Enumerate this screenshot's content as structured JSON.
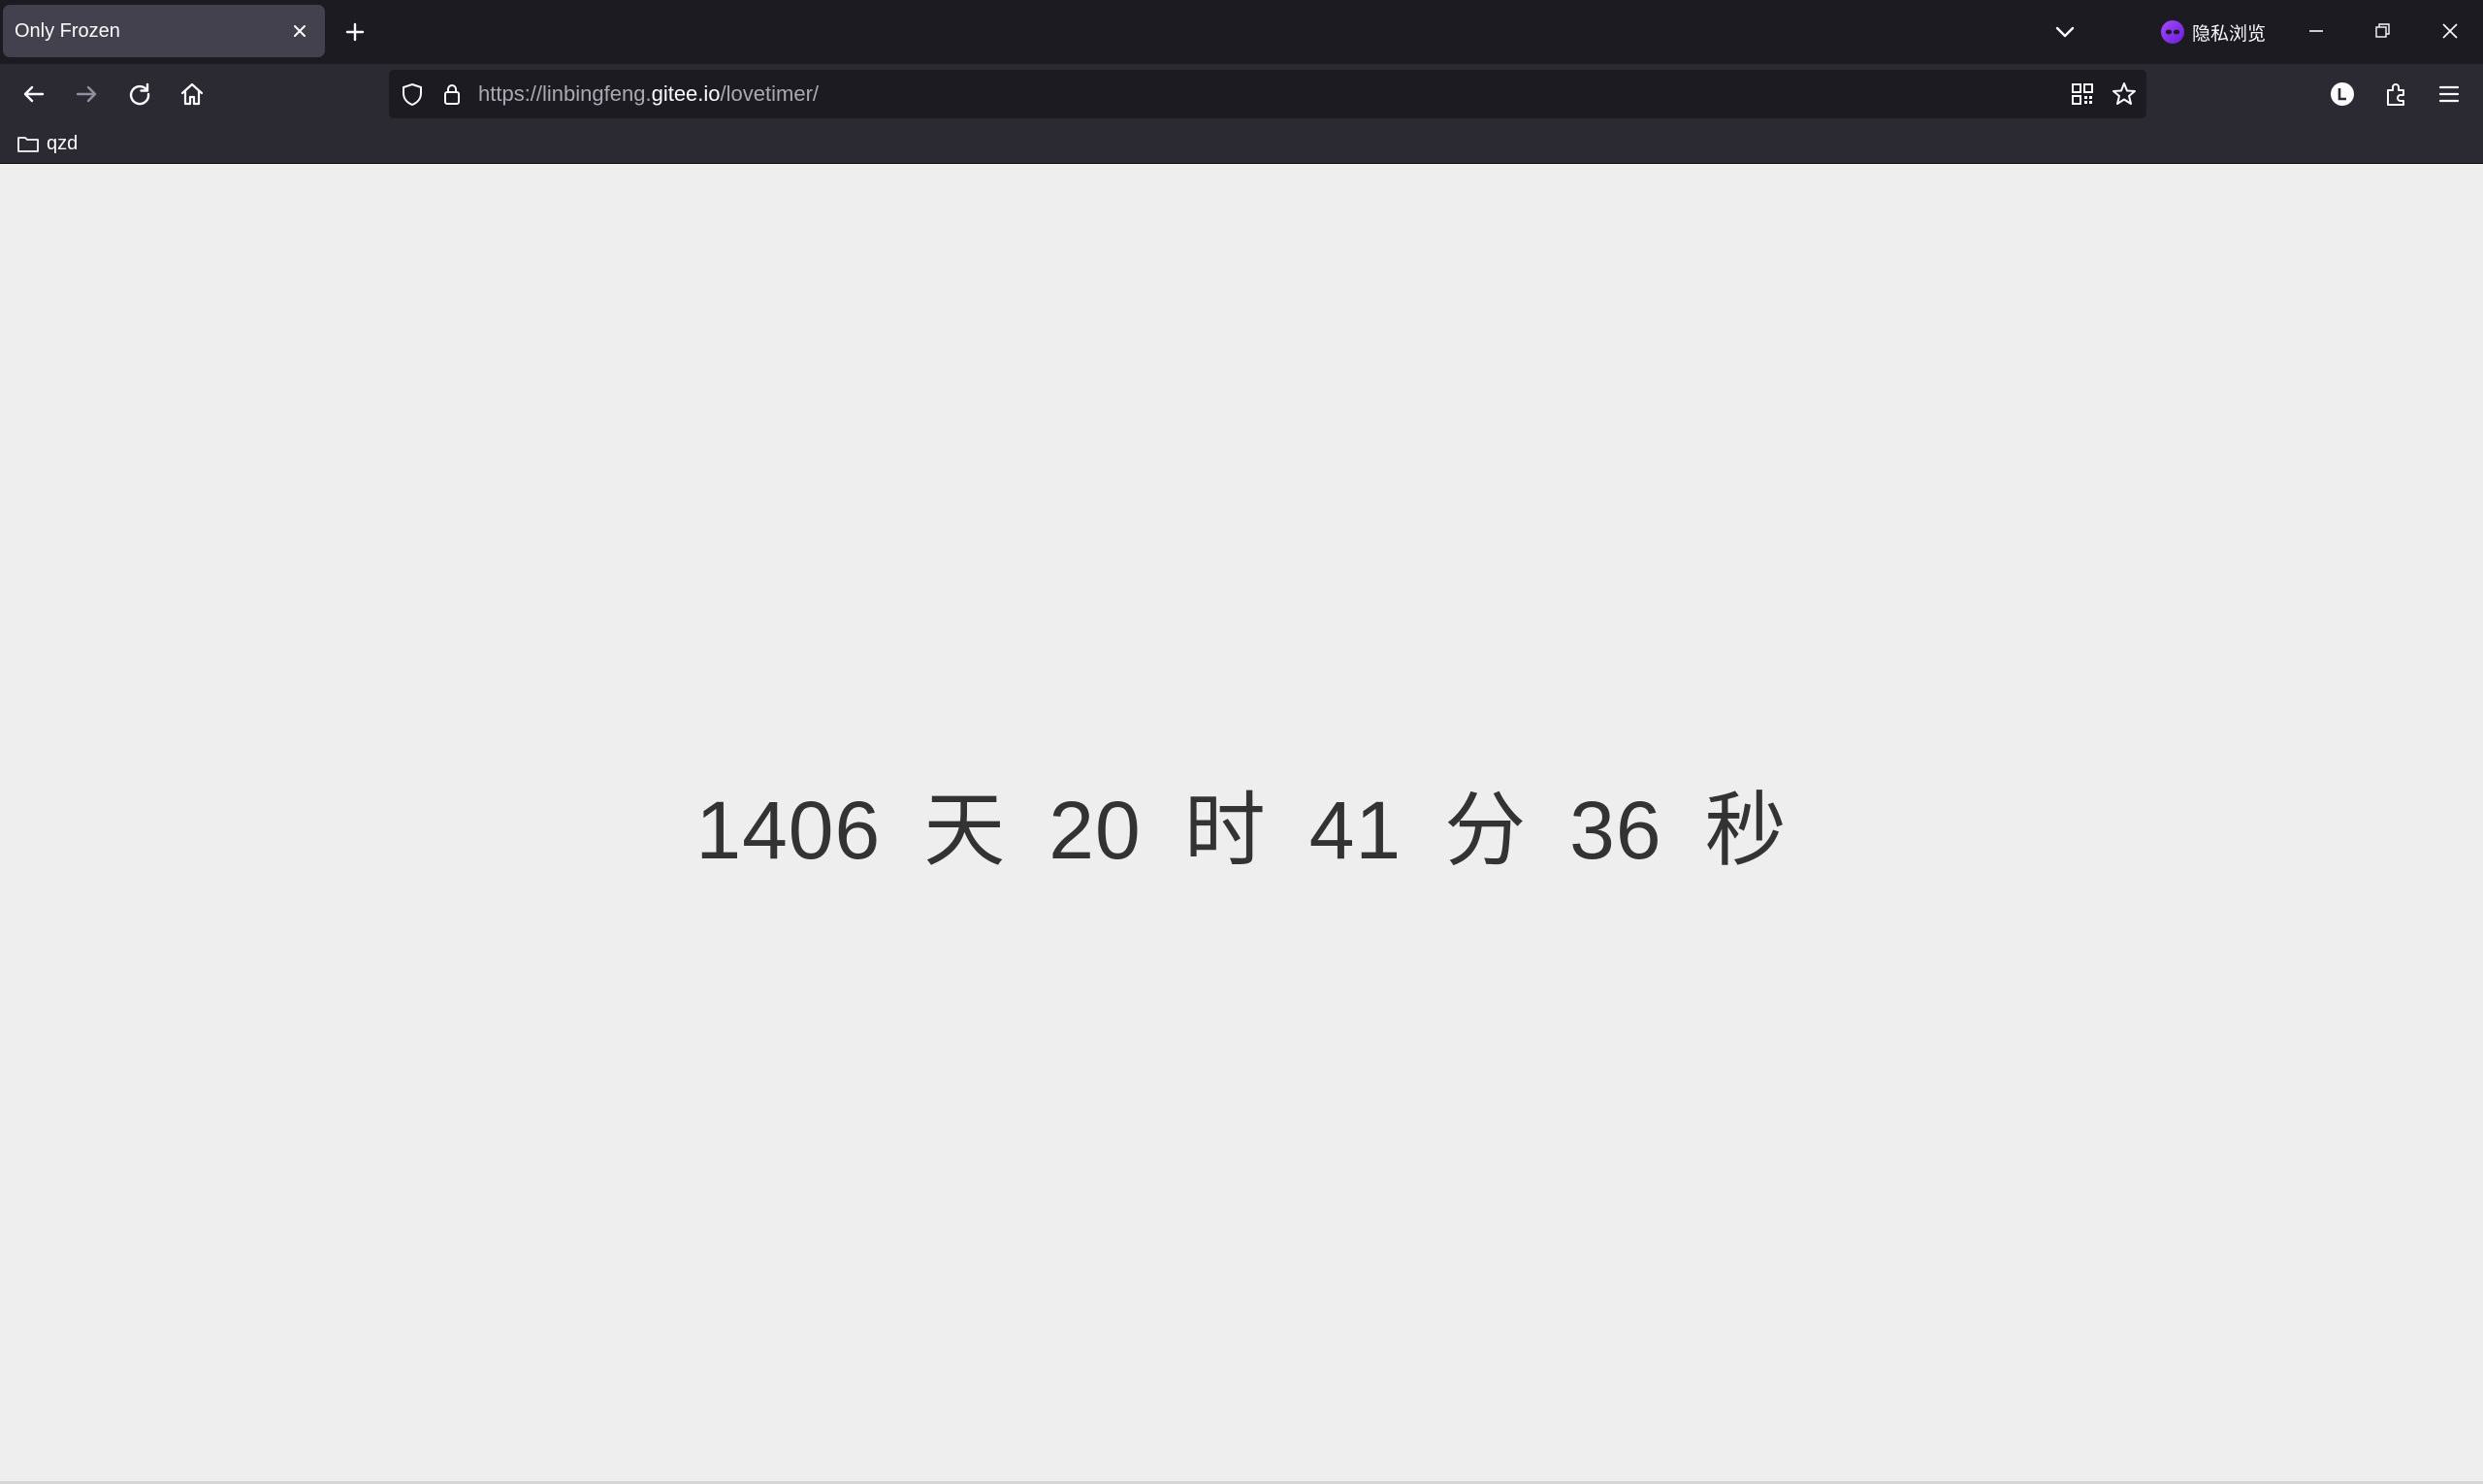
{
  "tabs": [
    {
      "title": "Only Frozen",
      "active": true
    }
  ],
  "private_browsing": {
    "label": "隐私浏览",
    "icon": "mask-icon"
  },
  "url": {
    "prefix": "https://linbingfeng.",
    "host": "gitee.io",
    "path": "/lovetimer/"
  },
  "bookmarks": [
    {
      "label": "qzd",
      "icon": "folder-icon"
    }
  ],
  "timer": {
    "days": "1406",
    "days_unit": "天",
    "hours": "20",
    "hours_unit": "时",
    "minutes": "41",
    "minutes_unit": "分",
    "seconds": "36",
    "seconds_unit": "秒"
  },
  "colors": {
    "tab_bar": "#1c1b22",
    "toolbar": "#2b2a33",
    "active_tab": "#42414d",
    "page_bg": "#eeeeee",
    "timer_text": "#333333",
    "private_accent": "#8a2be2"
  }
}
